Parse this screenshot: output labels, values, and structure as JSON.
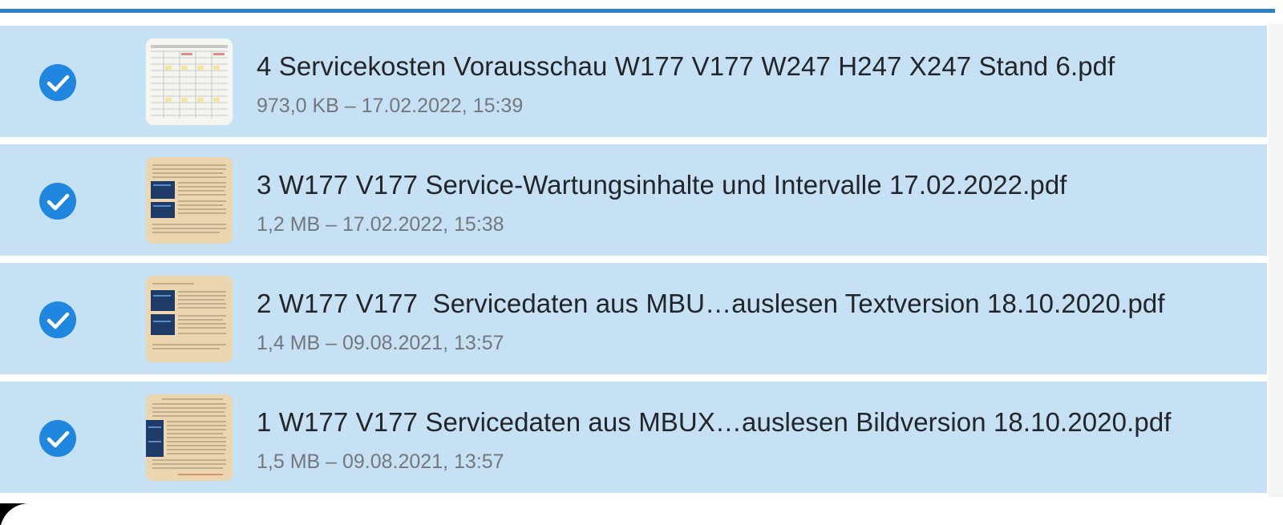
{
  "colors": {
    "accent": "#2f7fc9",
    "selected_row": "#c6e1f3",
    "check": "#1f87e0",
    "title_text": "#222529",
    "meta_text": "#72787e"
  },
  "files": [
    {
      "name": "4 Servicekosten Vorausschau W177 V177 W247 H247 X247 Stand 6.pdf",
      "meta": "973,0 KB – 17.02.2022, 15:39",
      "selected": true,
      "thumb": "spreadsheet-thumbnail-icon"
    },
    {
      "name": "3 W177 V177 Service-Wartungsinhalte und Intervalle 17.02.2022.pdf",
      "meta": "1,2 MB – 17.02.2022, 15:38",
      "selected": true,
      "thumb": "document-thumbnail-icon"
    },
    {
      "name": "2 W177 V177  Servicedaten aus MBU…auslesen Textversion 18.10.2020.pdf",
      "meta": "1,4 MB – 09.08.2021, 13:57",
      "selected": true,
      "thumb": "document-thumbnail-icon"
    },
    {
      "name": "1 W177 V177 Servicedaten aus MBUX…auslesen Bildversion 18.10.2020.pdf",
      "meta": "1,5 MB – 09.08.2021, 13:57",
      "selected": true,
      "thumb": "document-thumbnail-icon"
    }
  ]
}
